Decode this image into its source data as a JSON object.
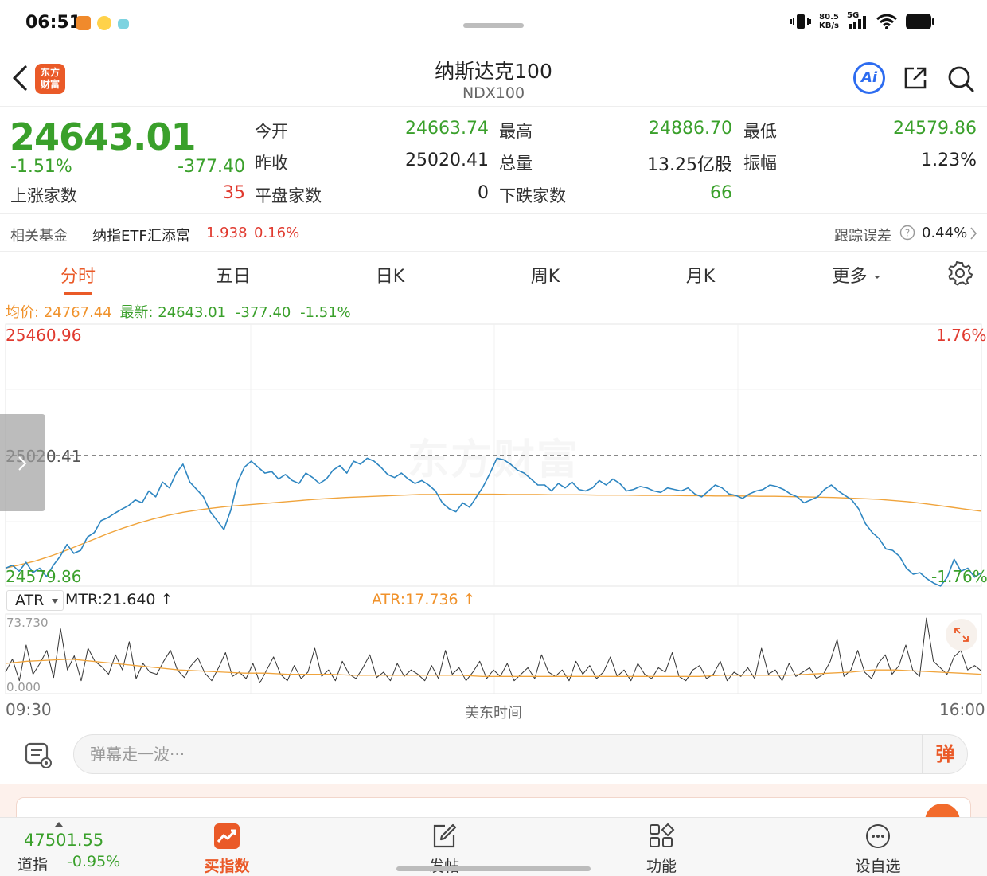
{
  "status": {
    "time": "06:51",
    "net_speed": "80.5",
    "net_unit": "KB/s",
    "network": "5G"
  },
  "nav": {
    "brand": "东方财富",
    "title": "纳斯达克100",
    "subtitle": "NDX100",
    "ai_label": "Ai"
  },
  "quote": {
    "price": "24643.01",
    "change_pct": "-1.51%",
    "change": "-377.40",
    "open_label": "今开",
    "open": "24663.74",
    "high_label": "最高",
    "high": "24886.70",
    "low_label": "最低",
    "low": "24579.86",
    "prev_label": "昨收",
    "prev": "25020.41",
    "volume_label": "总量",
    "volume": "13.25亿股",
    "amplitude_label": "振幅",
    "amplitude": "1.23%",
    "up_label": "上涨家数",
    "up": "35",
    "flat_label": "平盘家数",
    "flat": "0",
    "down_label": "下跌家数",
    "down": "66"
  },
  "fund": {
    "label": "相关基金",
    "name": "纳指ETF汇添富",
    "price": "1.938",
    "pct": "0.16%",
    "tracking_label": "跟踪误差",
    "tracking": "0.44%"
  },
  "tabs": [
    {
      "label": "分时",
      "active": true
    },
    {
      "label": "五日"
    },
    {
      "label": "日K"
    },
    {
      "label": "周K"
    },
    {
      "label": "月K"
    },
    {
      "label": "更多"
    }
  ],
  "info": {
    "avg_label": "均价:",
    "avg": "24767.44",
    "last_label": "最新:",
    "last": "24643.01",
    "chg": "-377.40",
    "pct": "-1.51%"
  },
  "chart_data": [
    {
      "type": "line",
      "title": "",
      "ylim": [
        24579.86,
        25460.96
      ],
      "axis_labels": {
        "y_top": "25460.96",
        "y_mid": "25020.41",
        "y_bottom": "24579.86",
        "pct_top": "1.76%",
        "pct_bottom": "-1.76%"
      },
      "reference_value": 25020.41,
      "series": [
        {
          "name": "最新",
          "color": "#2e86c1",
          "values": [
            24640,
            24650,
            24630,
            24660,
            24625,
            24640,
            24612,
            24650,
            24680,
            24720,
            24690,
            24700,
            24745,
            24760,
            24800,
            24810,
            24825,
            24838,
            24850,
            24870,
            24860,
            24900,
            24880,
            24930,
            24910,
            24960,
            24990,
            24930,
            24905,
            24880,
            24830,
            24800,
            24770,
            24835,
            24930,
            24980,
            25000,
            24980,
            24960,
            24965,
            24940,
            24955,
            24935,
            24925,
            24960,
            24945,
            24925,
            24940,
            24970,
            24985,
            24960,
            25000,
            24990,
            25010,
            25000,
            24980,
            24955,
            24945,
            24960,
            24940,
            24925,
            24935,
            24920,
            24900,
            24860,
            24840,
            24830,
            24860,
            24845,
            24880,
            24915,
            24960,
            25010,
            25005,
            24990,
            24970,
            24960,
            24940,
            24920,
            24920,
            24900,
            24925,
            24910,
            24930,
            24905,
            24900,
            24910,
            24935,
            24920,
            24940,
            24925,
            24900,
            24905,
            24915,
            24910,
            24900,
            24895,
            24910,
            24905,
            24900,
            24910,
            24890,
            24880,
            24900,
            24920,
            24910,
            24890,
            24885,
            24875,
            24890,
            24900,
            24905,
            24920,
            24915,
            24905,
            24890,
            24880,
            24860,
            24870,
            24880,
            24905,
            24920,
            24900,
            24885,
            24870,
            24840,
            24790,
            24760,
            24740,
            24705,
            24700,
            24680,
            24640,
            24620,
            24625,
            24605,
            24590,
            24580,
            24610,
            24670,
            24630,
            24640,
            24610,
            24625
          ]
        },
        {
          "name": "均价",
          "color": "#f0a43c",
          "values": [
            24640,
            24652,
            24664,
            24680,
            24698,
            24718,
            24738,
            24758,
            24776,
            24792,
            24806,
            24818,
            24828,
            24836,
            24842,
            24848,
            24852,
            24856,
            24860,
            24864,
            24868,
            24872,
            24875,
            24878,
            24880,
            24882,
            24884,
            24886,
            24888,
            24888,
            24889,
            24889,
            24889,
            24889,
            24888,
            24888,
            24888,
            24887,
            24887,
            24887,
            24886,
            24886,
            24886,
            24885,
            24885,
            24885,
            24884,
            24884,
            24883,
            24883,
            24883,
            24882,
            24882,
            24881,
            24880,
            24879,
            24878,
            24876,
            24874,
            24872,
            24868,
            24864,
            24858,
            24852,
            24845,
            24838,
            24832
          ]
        }
      ]
    },
    {
      "type": "line",
      "title": "",
      "ylim": [
        0,
        73.73
      ],
      "axis_labels": {
        "y_top": "73.730",
        "y_bottom": "0.000",
        "x_start": "09:30",
        "x_end": "16:00",
        "x_title": "美东时间"
      },
      "indicator": "ATR",
      "series": [
        {
          "name": "MTR",
          "legend": "MTR:21.640 ↑",
          "color": "#333333",
          "values": [
            20,
            32,
            12,
            45,
            18,
            28,
            40,
            15,
            60,
            22,
            35,
            12,
            42,
            30,
            25,
            18,
            36,
            22,
            48,
            14,
            28,
            20,
            18,
            30,
            40,
            22,
            15,
            26,
            33,
            19,
            12,
            24,
            38,
            16,
            20,
            14,
            28,
            10,
            22,
            34,
            18,
            12,
            26,
            14,
            20,
            42,
            16,
            22,
            12,
            30,
            18,
            14,
            24,
            36,
            15,
            20,
            12,
            28,
            16,
            22,
            18,
            12,
            26,
            14,
            40,
            18,
            24,
            12,
            20,
            30,
            14,
            22,
            16,
            28,
            12,
            18,
            24,
            14,
            36,
            20,
            16,
            22,
            12,
            30,
            18,
            26,
            14,
            20,
            34,
            16,
            22,
            12,
            28,
            18,
            14,
            24,
            20,
            38,
            16,
            12,
            22,
            26,
            14,
            18,
            30,
            12,
            20,
            16,
            24,
            14,
            42,
            18,
            22,
            12,
            28,
            16,
            20,
            24,
            14,
            18,
            30,
            50,
            16,
            22,
            40,
            20,
            14,
            28,
            36,
            18,
            26,
            45,
            22,
            16,
            70,
            30,
            24,
            18,
            34,
            40,
            22,
            26,
            21
          ]
        },
        {
          "name": "ATR",
          "legend": "ATR:17.736 ↑",
          "color": "#f0a43c",
          "values": [
            28,
            30,
            31,
            32,
            30,
            28,
            26,
            24,
            22,
            21,
            20,
            19,
            19,
            18,
            18,
            18,
            17,
            17,
            17,
            17,
            17,
            17,
            16,
            16,
            16,
            16,
            16,
            16,
            16,
            16,
            16,
            16,
            16,
            17,
            17,
            17,
            17,
            18,
            19,
            20,
            22,
            22,
            21,
            20,
            19,
            18
          ]
        }
      ]
    }
  ],
  "danmu": {
    "placeholder": "弹幕走一波···",
    "toggle": "弹"
  },
  "bottom": {
    "index_value": "47501.55",
    "index_name": "道指",
    "index_pct": "-0.95%",
    "items": [
      {
        "label": "买指数"
      },
      {
        "label": "发帖"
      },
      {
        "label": "功能"
      },
      {
        "label": "设自选"
      }
    ]
  },
  "colors": {
    "green": "#3aa02b",
    "red": "#e03a2f",
    "accent": "#ea5a28",
    "price_line": "#2e86c1",
    "avg_line": "#f0a43c"
  }
}
